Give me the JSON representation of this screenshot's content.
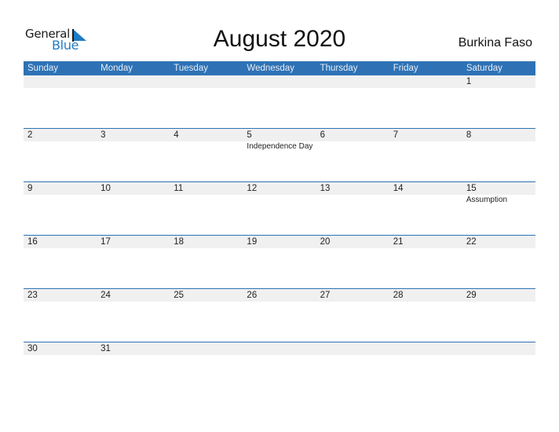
{
  "logo": {
    "line1": "General",
    "line2": "Blue"
  },
  "title": "August 2020",
  "country": "Burkina Faso",
  "colors": {
    "accent": "#2e72b5",
    "band": "#f0f0f0",
    "logo_blue": "#1f7bc4"
  },
  "weekdays": [
    "Sunday",
    "Monday",
    "Tuesday",
    "Wednesday",
    "Thursday",
    "Friday",
    "Saturday"
  ],
  "weeks": [
    [
      {
        "d": ""
      },
      {
        "d": ""
      },
      {
        "d": ""
      },
      {
        "d": ""
      },
      {
        "d": ""
      },
      {
        "d": ""
      },
      {
        "d": "1"
      }
    ],
    [
      {
        "d": "2"
      },
      {
        "d": "3"
      },
      {
        "d": "4"
      },
      {
        "d": "5",
        "ev": "Independence Day"
      },
      {
        "d": "6"
      },
      {
        "d": "7"
      },
      {
        "d": "8"
      }
    ],
    [
      {
        "d": "9"
      },
      {
        "d": "10"
      },
      {
        "d": "11"
      },
      {
        "d": "12"
      },
      {
        "d": "13"
      },
      {
        "d": "14"
      },
      {
        "d": "15",
        "ev": "Assumption"
      }
    ],
    [
      {
        "d": "16"
      },
      {
        "d": "17"
      },
      {
        "d": "18"
      },
      {
        "d": "19"
      },
      {
        "d": "20"
      },
      {
        "d": "21"
      },
      {
        "d": "22"
      }
    ],
    [
      {
        "d": "23"
      },
      {
        "d": "24"
      },
      {
        "d": "25"
      },
      {
        "d": "26"
      },
      {
        "d": "27"
      },
      {
        "d": "28"
      },
      {
        "d": "29"
      }
    ],
    [
      {
        "d": "30"
      },
      {
        "d": "31"
      },
      {
        "d": ""
      },
      {
        "d": ""
      },
      {
        "d": ""
      },
      {
        "d": ""
      },
      {
        "d": ""
      }
    ]
  ]
}
